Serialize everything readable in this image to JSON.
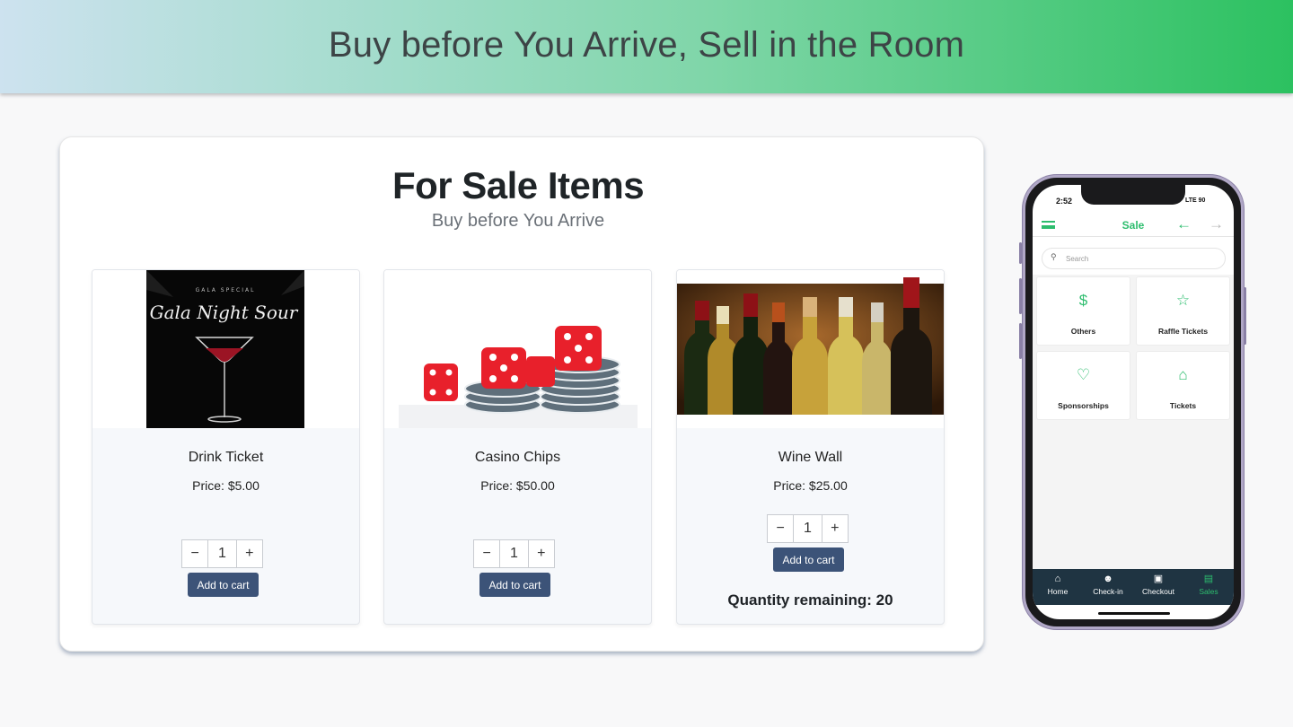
{
  "banner": {
    "title": "Buy before You Arrive, Sell in the Room"
  },
  "panel": {
    "title": "For Sale Items",
    "subtitle": "Buy before You Arrive",
    "cards": [
      {
        "name": "Drink Ticket",
        "price": "Price: $5.00",
        "qty": "1",
        "add_label": "Add to cart",
        "image": {
          "caption_top": "GALA SPECIAL",
          "caption": "Gala Night Sour"
        }
      },
      {
        "name": "Casino Chips",
        "price": "Price: $50.00",
        "qty": "1",
        "add_label": "Add to cart"
      },
      {
        "name": "Wine Wall",
        "price": "Price: $25.00",
        "qty": "1",
        "add_label": "Add to cart",
        "remaining": "Quantity remaining: 20"
      }
    ]
  },
  "phone": {
    "time": "2:52",
    "status": "LTE 90",
    "title": "Sale",
    "search_placeholder": "Search",
    "tiles": [
      {
        "label": "Others",
        "icon": "dollar-icon"
      },
      {
        "label": "Raffle Tickets",
        "icon": "ticket-icon"
      },
      {
        "label": "Sponsorships",
        "icon": "handshake-icon"
      },
      {
        "label": "Tickets",
        "icon": "stadium-icon"
      }
    ],
    "tabs": [
      {
        "label": "Home",
        "icon": "home-icon"
      },
      {
        "label": "Check-in",
        "icon": "user-check-icon"
      },
      {
        "label": "Checkout",
        "icon": "cart-icon"
      },
      {
        "label": "Sales",
        "icon": "store-icon"
      }
    ]
  },
  "colors": {
    "accent": "#2dbd6e",
    "button": "#3c5378",
    "tabbar": "#1f3442"
  }
}
